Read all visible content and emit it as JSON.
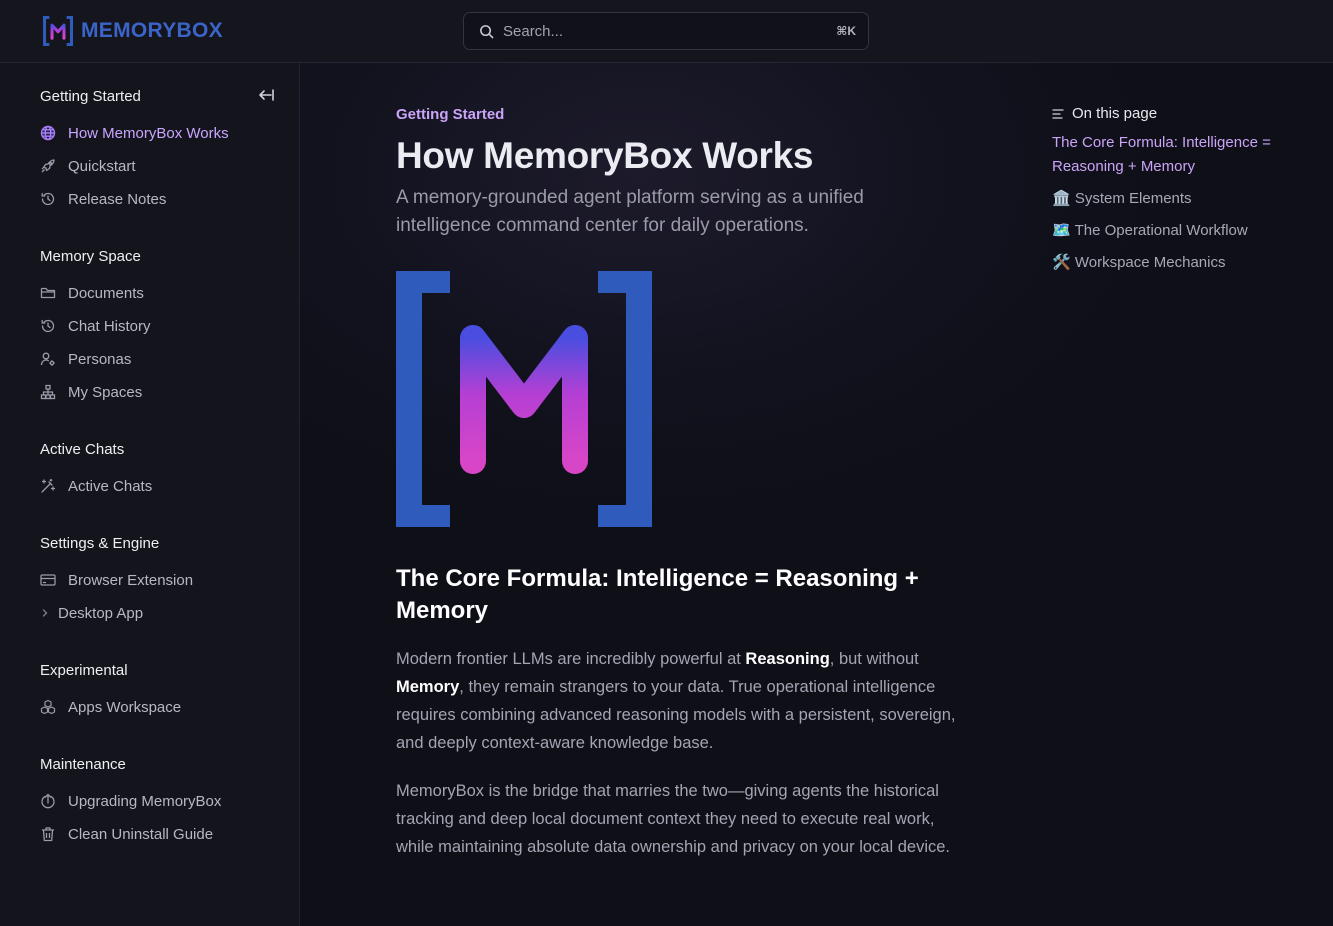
{
  "brand": {
    "name": "MEMORYBOX"
  },
  "search": {
    "placeholder": "Search...",
    "shortcut": "⌘K"
  },
  "sidebar": {
    "sections": [
      {
        "title": "Getting Started",
        "items": [
          {
            "label": "How MemoryBox Works",
            "icon": "globe-icon",
            "active": true
          },
          {
            "label": "Quickstart",
            "icon": "rocket-icon"
          },
          {
            "label": "Release Notes",
            "icon": "history-icon"
          }
        ]
      },
      {
        "title": "Memory Space",
        "items": [
          {
            "label": "Documents",
            "icon": "folder-icon"
          },
          {
            "label": "Chat History",
            "icon": "history-icon"
          },
          {
            "label": "Personas",
            "icon": "user-settings-icon"
          },
          {
            "label": "My Spaces",
            "icon": "network-icon"
          }
        ]
      },
      {
        "title": "Active Chats",
        "items": [
          {
            "label": "Active Chats",
            "icon": "magic-wand-icon"
          }
        ]
      },
      {
        "title": "Settings & Engine",
        "items": [
          {
            "label": "Browser Extension",
            "icon": "credit-card-icon"
          },
          {
            "label": "Desktop App",
            "icon": "chevron-right-icon"
          }
        ]
      },
      {
        "title": "Experimental",
        "items": [
          {
            "label": "Apps Workspace",
            "icon": "boxes-icon"
          }
        ]
      },
      {
        "title": "Maintenance",
        "items": [
          {
            "label": "Upgrading MemoryBox",
            "icon": "upload-icon"
          },
          {
            "label": "Clean Uninstall Guide",
            "icon": "trash-icon"
          }
        ]
      }
    ]
  },
  "page": {
    "breadcrumb": "Getting Started",
    "title": "How MemoryBox Works",
    "lead": "A memory-grounded agent platform serving as a unified intelligence command center for daily operations.",
    "section_title": "The Core Formula: Intelligence = Reasoning + Memory",
    "p1": {
      "t1": "Modern frontier LLMs are incredibly powerful at ",
      "b1": "Reasoning",
      "t2": ", but without ",
      "b2": "Memory",
      "t3": ", they remain strangers to your data. True operational intelligence requires combining advanced reasoning models with a persistent, sovereign, and deeply context-aware knowledge base."
    },
    "p2": "MemoryBox is the bridge that marries the two—giving agents the historical tracking and deep local document context they need to execute real work, while maintaining absolute data ownership and privacy on your local device."
  },
  "toc": {
    "title": "On this page",
    "items": [
      {
        "label": "The Core Formula: Intelligence = Reasoning + Memory",
        "active": true
      },
      {
        "label": "🏛️ System Elements"
      },
      {
        "label": "🗺️ The Operational Workflow"
      },
      {
        "label": "🛠️ Workspace Mechanics"
      }
    ]
  },
  "colors": {
    "accent": "#c9a4f7",
    "brand_blue": "#2f5bbd",
    "background": "#0f0f18"
  }
}
